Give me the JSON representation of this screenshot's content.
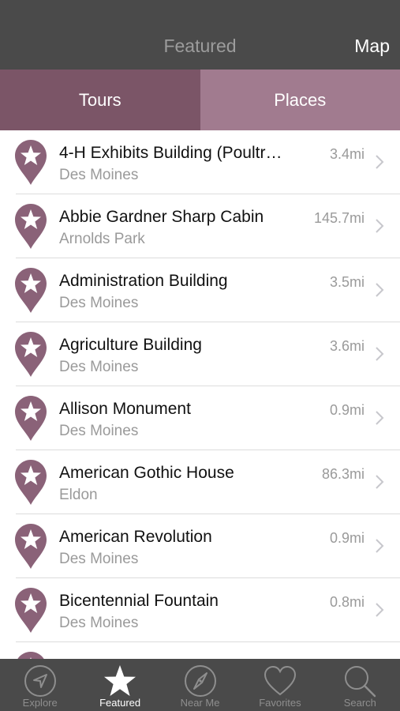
{
  "header": {
    "title": "Featured",
    "map_label": "Map"
  },
  "segments": {
    "tours": "Tours",
    "places": "Places",
    "selected": "Places"
  },
  "colors": {
    "accent": "#8a6278",
    "tours_bg": "#7b5567",
    "places_bg": "#a17b8f",
    "bar_bg": "#4a4a4a"
  },
  "places": [
    {
      "title": "4-H Exhibits Building (Poultr…",
      "city": "Des Moines",
      "distance": "3.4mi"
    },
    {
      "title": "Abbie Gardner Sharp Cabin",
      "city": "Arnolds Park",
      "distance": "145.7mi"
    },
    {
      "title": "Administration Building",
      "city": "Des Moines",
      "distance": "3.5mi"
    },
    {
      "title": "Agriculture Building",
      "city": "Des Moines",
      "distance": "3.6mi"
    },
    {
      "title": "Allison Monument",
      "city": "Des Moines",
      "distance": "0.9mi"
    },
    {
      "title": "American Gothic House",
      "city": "Eldon",
      "distance": "86.3mi"
    },
    {
      "title": "American Revolution",
      "city": "Des Moines",
      "distance": "0.9mi"
    },
    {
      "title": "Bicentennial Fountain",
      "city": "Des Moines",
      "distance": "0.8mi"
    },
    {
      "title": "",
      "city": "",
      "distance": ""
    }
  ],
  "tabbar": {
    "items": [
      {
        "label": "Explore",
        "icon": "compass-arrow-icon"
      },
      {
        "label": "Featured",
        "icon": "star-icon",
        "active": true
      },
      {
        "label": "Near Me",
        "icon": "compass-needle-icon"
      },
      {
        "label": "Favorites",
        "icon": "heart-icon"
      },
      {
        "label": "Search",
        "icon": "magnifier-icon"
      }
    ]
  }
}
